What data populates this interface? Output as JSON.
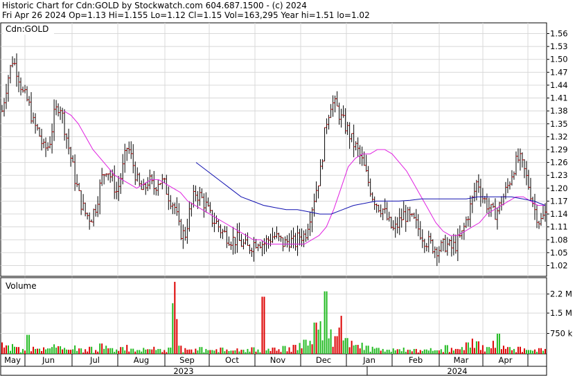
{
  "chart_data": {
    "type": "ohlc",
    "title": "Historic Chart for Cdn:GOLD by Stockwatch.com 604.687.1500 - (c) 2024",
    "subtitle": "Fri Apr 26 2024  Op=1.13  Hi=1.155  Lo=1.12  Cl=1.15  Vol=163,295  Year hi=1.51  lo=1.02",
    "symbol": "Cdn:GOLD",
    "price_ticks": [
      "1.56",
      "1.53",
      "1.50",
      "1.47",
      "1.44",
      "1.41",
      "1.38",
      "1.35",
      "1.32",
      "1.29",
      "1.26",
      "1.23",
      "1.20",
      "1.17",
      "1.14",
      "1.11",
      "1.08",
      "1.05",
      "1.02"
    ],
    "ylim": [
      0.995,
      1.585
    ],
    "volume_label": "Volume",
    "volume_ticks": [
      "2.2 M",
      "1.5 M",
      "750 k"
    ],
    "volume_max": 2700000,
    "months": [
      "May",
      "Jun",
      "Jul",
      "Aug",
      "Sep",
      "Oct",
      "Nov",
      "Dec",
      "Jan",
      "Feb",
      "Mar",
      "Apr"
    ],
    "years": [
      "2023",
      "2024"
    ],
    "price_series": [
      [
        1.38,
        1.45,
        1.5,
        1.47,
        1.42,
        1.4,
        1.35,
        1.33,
        1.29,
        1.3,
        1.37,
        1.4,
        1.34,
        1.28,
        1.22,
        1.17,
        1.14,
        1.13,
        1.16,
        1.22,
        1.25,
        1.22,
        1.19,
        1.24,
        1.3,
        1.26,
        1.21,
        1.19,
        1.22,
        1.2,
        1.22,
        1.21,
        1.18,
        1.16,
        1.1,
        1.09,
        1.15,
        1.19,
        1.18,
        1.16,
        1.13,
        1.12,
        1.1,
        1.09,
        1.08,
        1.08,
        1.07,
        1.06,
        1.07,
        1.08,
        1.07,
        1.08,
        1.09,
        1.08,
        1.07,
        1.08,
        1.07,
        1.09,
        1.09,
        1.14,
        1.19,
        1.24,
        1.35,
        1.4,
        1.39,
        1.36,
        1.34,
        1.31,
        1.29,
        1.26,
        1.22,
        1.18,
        1.16,
        1.15,
        1.12,
        1.1,
        1.12,
        1.14,
        1.13,
        1.12,
        1.1,
        1.08,
        1.07,
        1.06,
        1.06,
        1.07,
        1.06,
        1.07,
        1.09,
        1.13,
        1.17,
        1.22,
        1.18,
        1.16,
        1.14,
        1.15,
        1.18,
        1.21,
        1.25,
        1.27,
        1.24,
        1.2,
        1.15,
        1.12,
        1.14
      ]
    ],
    "volume_series": [
      [
        420000,
        310000,
        360000,
        250000,
        180000,
        700000,
        260000,
        190000,
        240000,
        200000,
        350000,
        280000,
        220000,
        150000,
        310000,
        200000,
        170000,
        260000,
        140000,
        380000,
        300000,
        210000,
        160000,
        250000,
        330000,
        190000,
        140000,
        220000,
        170000,
        260000,
        180000,
        140000,
        230000,
        2650000,
        300000,
        210000,
        160000,
        190000,
        250000,
        180000,
        140000,
        170000,
        230000,
        160000,
        120000,
        200000,
        150000,
        180000,
        240000,
        160000,
        2100000,
        190000,
        230000,
        170000,
        290000,
        240000,
        330000,
        400000,
        520000,
        480000,
        1150000,
        1200000,
        2300000,
        900000,
        650000,
        1400000,
        580000,
        480000,
        330000,
        410000,
        300000,
        260000,
        220000,
        180000,
        150000,
        200000,
        170000,
        230000,
        150000,
        180000,
        140000,
        160000,
        210000,
        130000,
        170000,
        320000,
        220000,
        180000,
        250000,
        420000,
        560000,
        460000,
        320000,
        250000,
        480000,
        740000,
        300000,
        250000,
        180000,
        260000,
        200000,
        140000,
        160000,
        210000,
        180000
      ]
    ],
    "ma_short": [
      1.38,
      1.37,
      1.35,
      1.32,
      1.29,
      1.27,
      1.25,
      1.23,
      1.22,
      1.21,
      1.2,
      1.21,
      1.22,
      1.22,
      1.21,
      1.2,
      1.19,
      1.17,
      1.16,
      1.15,
      1.14,
      1.13,
      1.12,
      1.11,
      1.1,
      1.09,
      1.08,
      1.08,
      1.07,
      1.07,
      1.07,
      1.07,
      1.07,
      1.07,
      1.08,
      1.09,
      1.11,
      1.15,
      1.2,
      1.25,
      1.27,
      1.28,
      1.28,
      1.29,
      1.29,
      1.28,
      1.26,
      1.24,
      1.21,
      1.18,
      1.15,
      1.12,
      1.1,
      1.09,
      1.09,
      1.1,
      1.11,
      1.12,
      1.14,
      1.15,
      1.16,
      1.17,
      1.18,
      1.18,
      1.17,
      1.16,
      1.16
    ],
    "ma_long": [
      1.26,
      1.24,
      1.22,
      1.2,
      1.18,
      1.17,
      1.16,
      1.155,
      1.15,
      1.15,
      1.145,
      1.14,
      1.14,
      1.15,
      1.16,
      1.165,
      1.17,
      1.17,
      1.17,
      1.172,
      1.175,
      1.175,
      1.175,
      1.175,
      1.175,
      1.18,
      1.18,
      1.18,
      1.18,
      1.175,
      1.17,
      1.16
    ]
  }
}
